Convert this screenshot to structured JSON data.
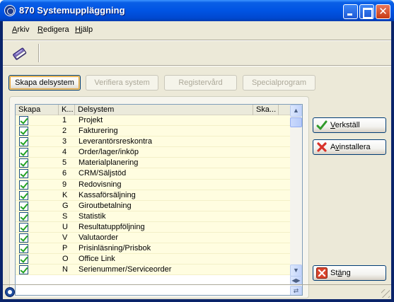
{
  "window": {
    "title": "870 Systemuppläggning"
  },
  "menu": [
    {
      "accel": "A",
      "rest": "rkiv"
    },
    {
      "accel": "R",
      "rest": "edigera"
    },
    {
      "accel": "H",
      "rest": "jälp"
    }
  ],
  "toolbar": {
    "icon": "book-icon"
  },
  "top_buttons": [
    {
      "label": "Skapa delsystem",
      "enabled": true
    },
    {
      "label": "Verifiera system",
      "enabled": false
    },
    {
      "label": "Registervård",
      "enabled": false
    },
    {
      "label": "Specialprogram",
      "enabled": false
    }
  ],
  "grid": {
    "columns": [
      "Skapa",
      "K...",
      "Delsystem",
      "Ska..."
    ],
    "rows": [
      {
        "checked": true,
        "code": "1",
        "name": "Projekt"
      },
      {
        "checked": true,
        "code": "2",
        "name": "Fakturering"
      },
      {
        "checked": true,
        "code": "3",
        "name": "Leverantörsreskontra"
      },
      {
        "checked": true,
        "code": "4",
        "name": "Order/lager/inköp"
      },
      {
        "checked": true,
        "code": "5",
        "name": "Materialplanering"
      },
      {
        "checked": true,
        "code": "6",
        "name": "CRM/Säljstöd"
      },
      {
        "checked": true,
        "code": "9",
        "name": "Redovisning"
      },
      {
        "checked": true,
        "code": "K",
        "name": "Kassaförsäljning"
      },
      {
        "checked": true,
        "code": "G",
        "name": "Giroutbetalning"
      },
      {
        "checked": true,
        "code": "S",
        "name": "Statistik"
      },
      {
        "checked": true,
        "code": "U",
        "name": "Resultatuppföljning"
      },
      {
        "checked": true,
        "code": "V",
        "name": "Valutaorder"
      },
      {
        "checked": true,
        "code": "P",
        "name": "Prisinläsning/Prisbok"
      },
      {
        "checked": true,
        "code": "O",
        "name": "Office Link"
      },
      {
        "checked": true,
        "code": "N",
        "name": "Serienummer/Serviceorder"
      }
    ]
  },
  "actions": {
    "apply": {
      "accel": "V",
      "rest": "erkställ",
      "icon": "checkmark-icon"
    },
    "uninstall": {
      "pre": "A",
      "accel": "v",
      "rest": "installera",
      "icon": "x-icon"
    },
    "close": {
      "pre": "St",
      "accel": "ä",
      "rest": "ng",
      "icon": "close-x-icon"
    }
  },
  "colors": {
    "titlebar": "#0054e3",
    "row_bg": "#fffde0",
    "check": "#21a121"
  }
}
